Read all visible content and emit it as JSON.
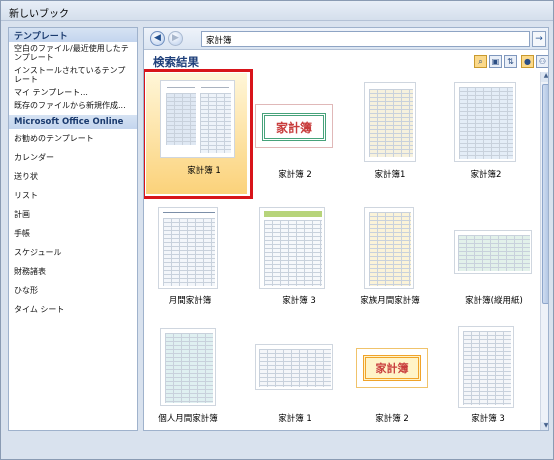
{
  "window": {
    "title": "新しいブック"
  },
  "sidebar": {
    "header": "テンプレート",
    "items_top": [
      "空白のファイル/最近使用したテンプレート",
      "インストールされているテンプレート",
      "マイ テンプレート...",
      "既存のファイルから新規作成..."
    ],
    "section": "Microsoft Office Online",
    "items_online": [
      "お勧めのテンプレート",
      "カレンダー",
      "送り状",
      "リスト",
      "計画",
      "手帳",
      "スケジュール",
      "財務諸表",
      "ひな形",
      "タイム シート"
    ]
  },
  "nav": {
    "back_label": "◀",
    "forward_label": "▶",
    "search_value": "家計簿",
    "go_label": "→"
  },
  "results": {
    "title": "検索結果",
    "items": [
      {
        "caption": "家計簿 1"
      },
      {
        "caption": "家計簿 2"
      },
      {
        "caption": "家計簿1"
      },
      {
        "caption": "家計簿2"
      },
      {
        "caption": "月間家計簿"
      },
      {
        "caption": "家計簿 3"
      },
      {
        "caption": "家族月間家計簿"
      },
      {
        "caption": "家計簿(縦用紙)"
      },
      {
        "caption": "個人月間家計簿"
      },
      {
        "caption": "家計簿 1"
      },
      {
        "caption": "家計簿 2"
      },
      {
        "caption": "家計簿 3"
      }
    ],
    "banner_text": "家計簿"
  },
  "view_icons": [
    "zoom-icon",
    "zoom-out-icon",
    "sort-icon",
    "user-icon",
    "users-icon"
  ],
  "colors": {
    "selection_border": "#d8141a",
    "accent": "#1e3f7a"
  }
}
